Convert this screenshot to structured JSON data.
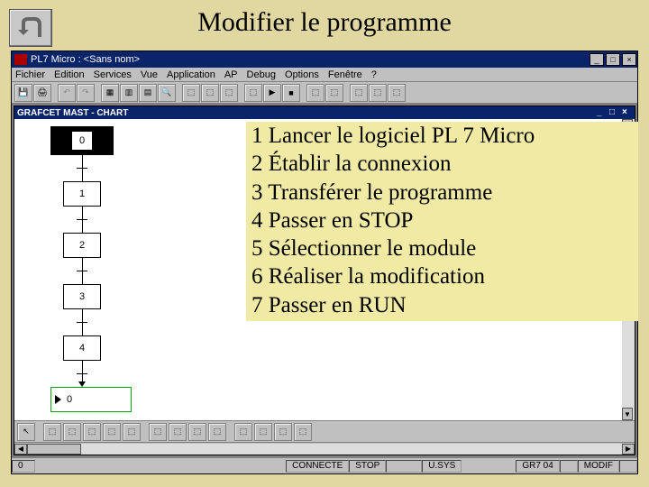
{
  "slide": {
    "title": "Modifier le programme"
  },
  "app": {
    "title": "PL7 Micro : <Sans nom>",
    "menus": [
      "Fichier",
      "Edition",
      "Services",
      "Vue",
      "Application",
      "AP",
      "Debug",
      "Options",
      "Fenêtre",
      "?"
    ]
  },
  "child": {
    "title": "GRAFCET MAST - CHART"
  },
  "grafcet": {
    "steps": [
      "0",
      "1",
      "2",
      "3",
      "4"
    ],
    "end_label": "0"
  },
  "instructions": [
    "1 Lancer le logiciel PL 7 Micro",
    "2 Établir la connexion",
    "3 Transférer le programme",
    "4 Passer en STOP",
    "5 Sélectionner le module",
    "6 Réaliser la modification",
    "7 Passer en RUN"
  ],
  "status": {
    "pos": "0",
    "connect": "CONNECTE",
    "run": "STOP",
    "mem": "U.SYS",
    "grid": "GR7 04",
    "mode": "MODIF"
  }
}
